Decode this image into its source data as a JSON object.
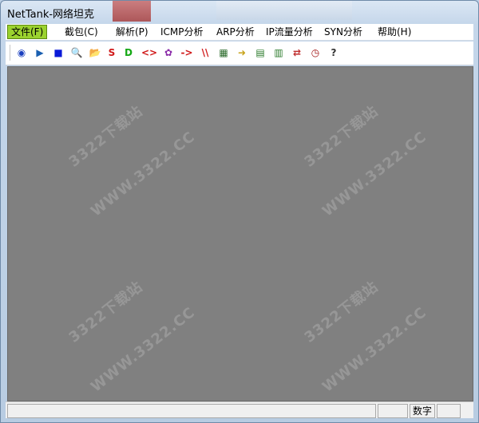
{
  "window": {
    "title": "NetTank-网络坦克"
  },
  "menubar": {
    "items": [
      {
        "label": "文件(F)"
      },
      {
        "label": "截包(C)"
      },
      {
        "label": "解析(P)"
      },
      {
        "label": "ICMP分析"
      },
      {
        "label": "ARP分析"
      },
      {
        "label": "IP流量分析"
      },
      {
        "label": "SYN分析"
      },
      {
        "label": "帮助(H)"
      }
    ]
  },
  "toolbar": {
    "buttons": [
      {
        "icon": "record-icon",
        "glyph": "◉"
      },
      {
        "icon": "play-icon",
        "glyph": "▶"
      },
      {
        "icon": "stop-icon",
        "glyph": "■"
      },
      {
        "icon": "search-icon",
        "glyph": "🔍"
      },
      {
        "icon": "open-folder-icon",
        "glyph": "📂"
      },
      {
        "icon": "source-icon",
        "glyph": "S"
      },
      {
        "icon": "destination-icon",
        "glyph": "D"
      },
      {
        "icon": "bidirectional-icon",
        "glyph": "<>"
      },
      {
        "icon": "filter-icon",
        "glyph": "✿"
      },
      {
        "icon": "direction-arrow-icon",
        "glyph": "->"
      },
      {
        "icon": "double-slash-icon",
        "glyph": "\\\\"
      },
      {
        "icon": "network-card-icon",
        "glyph": "▦"
      },
      {
        "icon": "goto-icon",
        "glyph": "➜"
      },
      {
        "icon": "computers-icon",
        "glyph": "▤"
      },
      {
        "icon": "hosts-icon",
        "glyph": "▥"
      },
      {
        "icon": "connections-icon",
        "glyph": "⇄"
      },
      {
        "icon": "clock-icon",
        "glyph": "◷"
      },
      {
        "icon": "help-icon",
        "glyph": "?"
      }
    ]
  },
  "statusbar": {
    "panels": [
      {
        "label": ""
      },
      {
        "label": ""
      },
      {
        "label": "数字"
      },
      {
        "label": ""
      }
    ]
  },
  "watermark": {
    "text_a": "3322下载站",
    "text_b": "WWW.3322.CC"
  },
  "colors": {
    "content_bg": "#808080",
    "menu_active": "#9bd22e"
  }
}
